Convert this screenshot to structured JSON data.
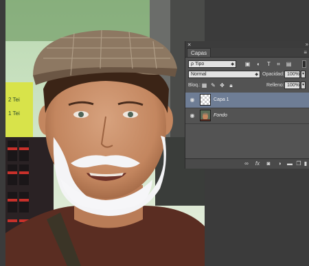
{
  "panel": {
    "close_glyph": "×",
    "collapse_glyph": "››",
    "tab_label": "Capas",
    "menu_glyph": "≡",
    "filter": {
      "search_glyph": "ρ",
      "value": "Tipo",
      "icons": [
        "image-filter-icon",
        "adjustment-filter-icon",
        "type-filter-icon",
        "shape-filter-icon",
        "smart-object-filter-icon"
      ]
    },
    "blend_mode": "Normal",
    "opacity_label": "Opacidad:",
    "opacity_value": "100%",
    "lock_label": "Bloq.:",
    "fill_label": "Relleno:",
    "fill_value": "100%",
    "layers": [
      {
        "name": "Capa 1",
        "selected": true,
        "visible": true,
        "italic": false
      },
      {
        "name": "Fondo",
        "selected": false,
        "visible": true,
        "italic": true
      }
    ],
    "footer_icons": [
      "link-icon",
      "fx-icon",
      "mask-icon",
      "adjustment-icon",
      "group-folder-icon",
      "new-layer-icon",
      "trash-icon"
    ],
    "footer_fx_label": "fx"
  },
  "colors": {
    "panel_bg": "#535353",
    "selected_layer": "#6e7d95",
    "canvas_bg": "#3b3b3b"
  }
}
